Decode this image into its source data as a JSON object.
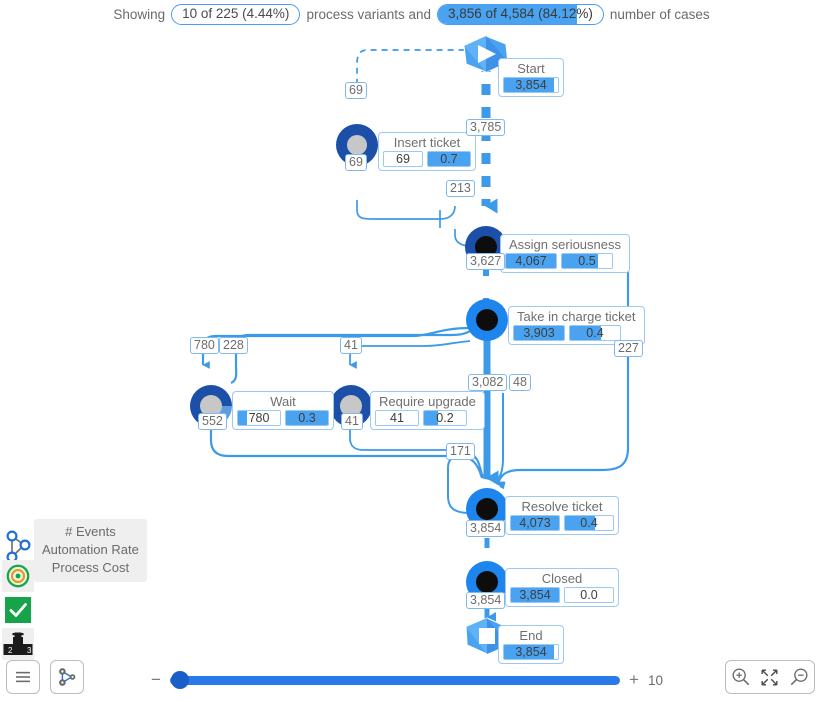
{
  "header": {
    "prefix": "Showing",
    "variants_pill": "10 of 225 (4.44%)",
    "middle": "process variants and",
    "cases_pill": "3,856 of 4,584 (84.12%)",
    "suffix": "number of cases",
    "cases_fill_percent": 84.12
  },
  "nodes": [
    {
      "id": "start",
      "label": "Start",
      "metrics": [
        {
          "value": "3,854",
          "fill": 92
        }
      ],
      "shape": "start-polygon"
    },
    {
      "id": "insert_ticket",
      "label": "Insert ticket",
      "metrics": [
        {
          "value": "69",
          "fill": 0
        },
        {
          "value": "0.7",
          "fill": 100
        }
      ],
      "shape": "ring-gray-core"
    },
    {
      "id": "assign_seriousness",
      "label": "Assign seriousness",
      "metrics": [
        {
          "value": "4,067",
          "fill": 100
        },
        {
          "value": "0.5",
          "fill": 72
        }
      ],
      "shape": "ring-dark-core"
    },
    {
      "id": "take_in_charge_ticket",
      "label": "Take in charge ticket",
      "metrics": [
        {
          "value": "3,903",
          "fill": 100
        },
        {
          "value": "0.4",
          "fill": 62
        }
      ],
      "shape": "ring-dark-core"
    },
    {
      "id": "wait",
      "label": "Wait",
      "metrics": [
        {
          "value": "780",
          "fill": 22
        },
        {
          "value": "0.3",
          "fill": 100
        }
      ],
      "shape": "ring-gray-core"
    },
    {
      "id": "require_upgrade",
      "label": "Require upgrade",
      "metrics": [
        {
          "value": "41",
          "fill": 0
        },
        {
          "value": "0.2",
          "fill": 34
        }
      ],
      "shape": "ring-gray-core"
    },
    {
      "id": "resolve_ticket",
      "label": "Resolve ticket",
      "metrics": [
        {
          "value": "4,073",
          "fill": 100
        },
        {
          "value": "0.4",
          "fill": 62
        }
      ],
      "shape": "ring-dark-core"
    },
    {
      "id": "closed",
      "label": "Closed",
      "metrics": [
        {
          "value": "3,854",
          "fill": 100
        },
        {
          "value": "0.0",
          "fill": 0
        }
      ],
      "shape": "ring-dark-core"
    },
    {
      "id": "end",
      "label": "End",
      "metrics": [
        {
          "value": "3,854",
          "fill": 92
        }
      ],
      "shape": "end-polygon"
    }
  ],
  "edges": [
    {
      "id": "start_to_insert",
      "label": "69"
    },
    {
      "id": "start_to_assign",
      "label": "3,785"
    },
    {
      "id": "insert_out",
      "label": "69"
    },
    {
      "id": "into_assign_left",
      "label": "213"
    },
    {
      "id": "assign_to_take",
      "label": "3,627"
    },
    {
      "id": "take_to_wait",
      "label": "780"
    },
    {
      "id": "wait_loop_back",
      "label": "228"
    },
    {
      "id": "take_to_require",
      "label": "41"
    },
    {
      "id": "take_to_resolve",
      "label": "3,082"
    },
    {
      "id": "take_branch_48",
      "label": "48"
    },
    {
      "id": "assign_to_resolve_right",
      "label": "227"
    },
    {
      "id": "wait_to_resolve",
      "label": "552"
    },
    {
      "id": "require_to_resolve",
      "label": "41"
    },
    {
      "id": "resolve_self_loop",
      "label": "171"
    },
    {
      "id": "resolve_to_closed",
      "label": "3,854"
    },
    {
      "id": "closed_to_end",
      "label": "3,854"
    }
  ],
  "legend": {
    "line1": "# Events",
    "line2": "Automation Rate",
    "line3": "Process Cost"
  },
  "tools": {
    "graph_legend_icon": "graph-nodes-icon",
    "target_icon": "target-icon",
    "check_icon": "check-icon",
    "podium_icon": "podium-icon",
    "menu_icon": "hamburger-menu-icon",
    "layout_icon": "graph-layout-icon"
  },
  "bottom": {
    "minus": "−",
    "plus": "+",
    "slider_value": "10",
    "slider_position_percent": 2,
    "zoom_in_icon": "zoom-in-icon",
    "fit_icon": "fit-to-screen-icon",
    "zoom_out_icon": "zoom-out-icon"
  },
  "colors": {
    "accent_blue": "#4aa3f0",
    "edge_blue": "#3d9ae8",
    "dark_ring": "#1b4fa8",
    "bright_ring": "#1e85ef",
    "slider_blue": "#2979e8",
    "green": "#17a34a"
  }
}
